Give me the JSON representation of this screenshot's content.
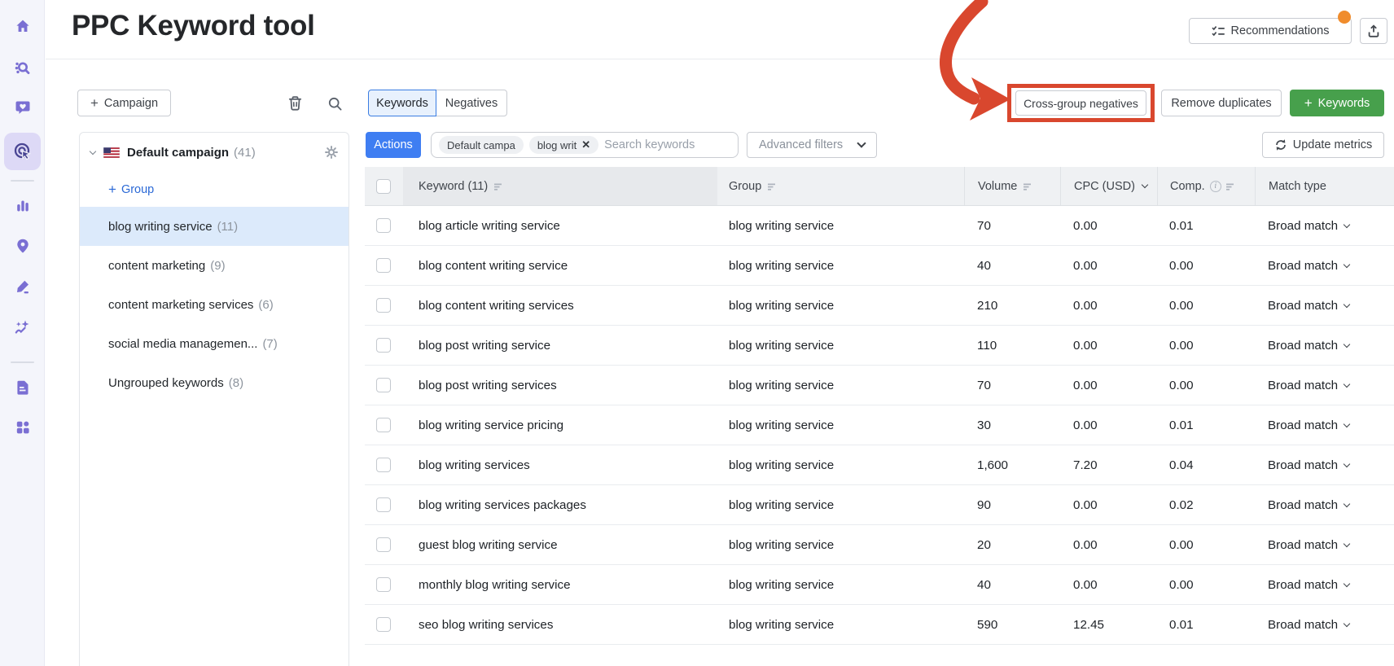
{
  "app": {
    "title": "PPC Keyword tool"
  },
  "header": {
    "recommendations_label": "Recommendations",
    "export_icon": "export-up-arrow-icon",
    "notification_dot_color": "#F08C2C"
  },
  "sidebar": {
    "icons": [
      "home",
      "keyword-research",
      "social-engagement",
      "advertising",
      "analytics",
      "local-listing",
      "content-writing",
      "ai-insights",
      "reports",
      "apps-grid"
    ],
    "active_icon": "advertising"
  },
  "left_panel": {
    "campaign_button_label": "Campaign",
    "tool_icons": [
      "trash",
      "search"
    ],
    "campaign_name": "Default campaign",
    "campaign_count": "(41)",
    "add_group_label": "Group",
    "groups": [
      {
        "name": "blog writing service",
        "count": "(11)",
        "selected": true
      },
      {
        "name": "content marketing",
        "count": "(9)",
        "selected": false
      },
      {
        "name": "content marketing services",
        "count": "(6)",
        "selected": false
      },
      {
        "name": "social media managemen...",
        "count": "(7)",
        "selected": false
      },
      {
        "name": "Ungrouped keywords",
        "count": "(8)",
        "selected": false
      }
    ]
  },
  "toolbar": {
    "tabs": [
      {
        "label": "Keywords",
        "active": true
      },
      {
        "label": "Negatives",
        "active": false
      }
    ],
    "cross_group_label": "Cross-group negatives",
    "remove_duplicates_label": "Remove duplicates",
    "add_keywords_label": "Keywords",
    "actions_label": "Actions",
    "filter_chips": [
      {
        "label": "Default campa",
        "removable": false
      },
      {
        "label": "blog writ",
        "removable": true
      }
    ],
    "search_placeholder": "Search keywords",
    "advanced_filters_label": "Advanced filters",
    "update_metrics_label": "Update metrics"
  },
  "table": {
    "header": {
      "keyword": "Keyword (11)",
      "group": "Group",
      "volume": "Volume",
      "cpc": "CPC (USD)",
      "comp": "Comp.",
      "match": "Match type"
    },
    "rows": [
      {
        "keyword": "blog article writing service",
        "group": "blog writing service",
        "volume": "70",
        "cpc": "0.00",
        "comp": "0.01",
        "match": "Broad match"
      },
      {
        "keyword": "blog content writing service",
        "group": "blog writing service",
        "volume": "40",
        "cpc": "0.00",
        "comp": "0.00",
        "match": "Broad match"
      },
      {
        "keyword": "blog content writing services",
        "group": "blog writing service",
        "volume": "210",
        "cpc": "0.00",
        "comp": "0.00",
        "match": "Broad match"
      },
      {
        "keyword": "blog post writing service",
        "group": "blog writing service",
        "volume": "110",
        "cpc": "0.00",
        "comp": "0.00",
        "match": "Broad match"
      },
      {
        "keyword": "blog post writing services",
        "group": "blog writing service",
        "volume": "70",
        "cpc": "0.00",
        "comp": "0.00",
        "match": "Broad match"
      },
      {
        "keyword": "blog writing service pricing",
        "group": "blog writing service",
        "volume": "30",
        "cpc": "0.00",
        "comp": "0.01",
        "match": "Broad match"
      },
      {
        "keyword": "blog writing services",
        "group": "blog writing service",
        "volume": "1,600",
        "cpc": "7.20",
        "comp": "0.04",
        "match": "Broad match"
      },
      {
        "keyword": "blog writing services packages",
        "group": "blog writing service",
        "volume": "90",
        "cpc": "0.00",
        "comp": "0.02",
        "match": "Broad match"
      },
      {
        "keyword": "guest blog writing service",
        "group": "blog writing service",
        "volume": "20",
        "cpc": "0.00",
        "comp": "0.00",
        "match": "Broad match"
      },
      {
        "keyword": "monthly blog writing service",
        "group": "blog writing service",
        "volume": "40",
        "cpc": "0.00",
        "comp": "0.00",
        "match": "Broad match"
      },
      {
        "keyword": "seo blog writing services",
        "group": "blog writing service",
        "volume": "590",
        "cpc": "12.45",
        "comp": "0.01",
        "match": "Broad match"
      }
    ]
  },
  "colors": {
    "annotation_red": "#D9472E",
    "primary_blue": "#3F7EF2",
    "add_green": "#47A04C",
    "link_blue": "#2B69D6",
    "tab_active_border": "#3B7DE2",
    "tab_active_bg": "#E8F1FD",
    "selected_group_bg": "#DCEAFB",
    "notification_orange": "#F08C2C",
    "sidebar_icon_purple": "#7A6FD3"
  }
}
